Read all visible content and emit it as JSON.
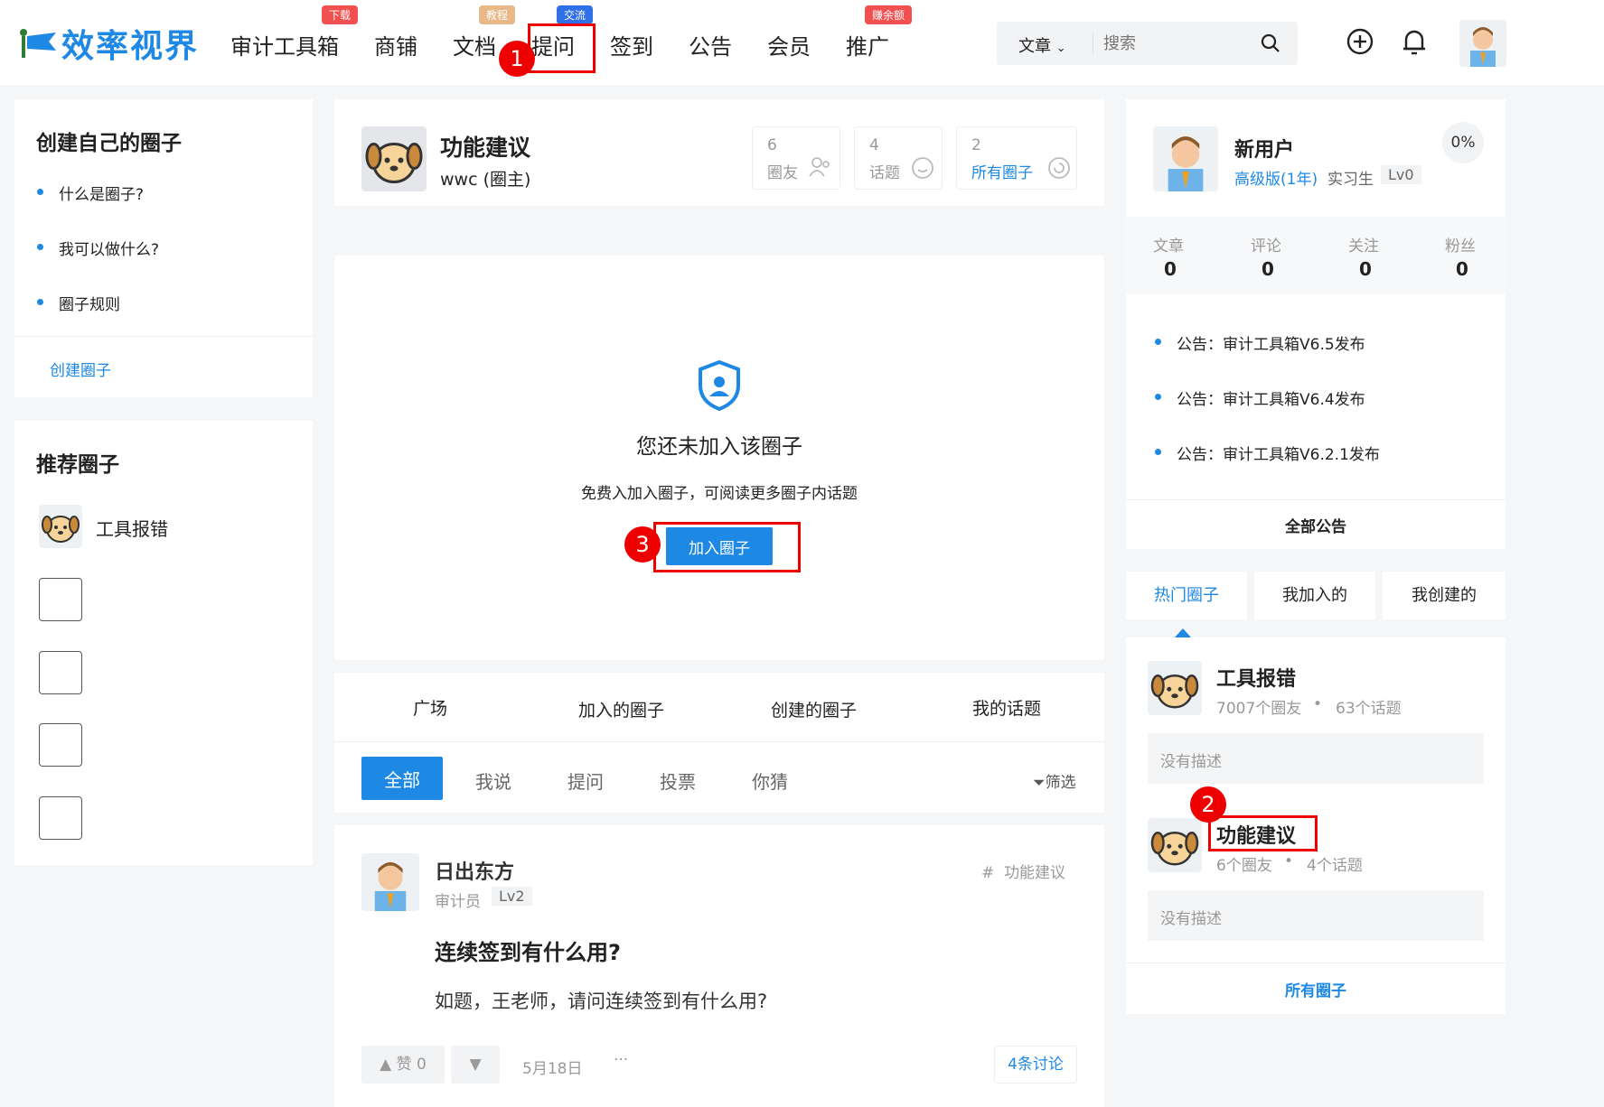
{
  "header": {
    "logo_text": "效率视界",
    "nav": [
      {
        "label": "审计工具箱",
        "badge": "下载",
        "badge_color": "#f05050"
      },
      {
        "label": "商铺"
      },
      {
        "label": "文档",
        "badge": "教程",
        "badge_color": "#e8b887"
      },
      {
        "label": "提问",
        "badge": "交流",
        "badge_color": "#2f6fe8"
      },
      {
        "label": "签到"
      },
      {
        "label": "公告"
      },
      {
        "label": "会员"
      },
      {
        "label": "推广",
        "badge": "赚余额",
        "badge_color": "#f05050"
      }
    ],
    "search": {
      "category": "文章",
      "placeholder": "搜索"
    },
    "icons": [
      "add-circle-icon",
      "bell-icon",
      "avatar"
    ]
  },
  "markers": [
    "1",
    "2",
    "3"
  ],
  "left": {
    "create_card": {
      "title": "创建自己的圈子",
      "items": [
        "什么是圈子?",
        "我可以做什么?",
        "圈子规则"
      ],
      "link": "创建圈子"
    },
    "recommend_card": {
      "title": "推荐圈子",
      "first_item": "工具报错"
    }
  },
  "center": {
    "circle": {
      "name": "功能建议",
      "owner": "wwc (圈主)",
      "stats": [
        {
          "num": "6",
          "label": "圈友"
        },
        {
          "num": "4",
          "label": "话题"
        },
        {
          "num": "2",
          "label": "所有圈子"
        }
      ]
    },
    "join": {
      "title": "您还未加入该圈子",
      "desc": "免费入加入圈子，可阅读更多圈子内话题",
      "button": "加入圈子"
    },
    "tabs": [
      "广场",
      "加入的圈子",
      "创建的圈子",
      "我的话题"
    ],
    "filters": [
      "全部",
      "我说",
      "提问",
      "投票",
      "你猜"
    ],
    "filter_button": "筛选",
    "post": {
      "author": "日出东方",
      "role": "审计员",
      "level": "Lv2",
      "tag": "功能建议",
      "title": "连续签到有什么用?",
      "body": "如题，王老师，请问连续签到有什么用?",
      "like": "赞 0",
      "date": "5月18日",
      "more": "···",
      "discuss": "4条讨论"
    }
  },
  "right": {
    "user": {
      "name": "新用户",
      "vip": "高级版(1年)",
      "title": "实习生",
      "level": "Lv0",
      "progress": "0%",
      "stats": [
        {
          "label": "文章",
          "value": "0"
        },
        {
          "label": "评论",
          "value": "0"
        },
        {
          "label": "关注",
          "value": "0"
        },
        {
          "label": "粉丝",
          "value": "0"
        }
      ]
    },
    "notices": [
      "公告：审计工具箱V6.5发布",
      "公告：审计工具箱V6.4发布",
      "公告：审计工具箱V6.2.1发布"
    ],
    "notices_all": "全部公告",
    "circle_tabs": [
      "热门圈子",
      "我加入的",
      "我创建的"
    ],
    "hot_circles": [
      {
        "name": "工具报错",
        "meta1": "7007个圈友",
        "meta2": "63个话题",
        "desc": "没有描述"
      },
      {
        "name": "功能建议",
        "meta1": "6个圈友",
        "meta2": "4个话题",
        "desc": "没有描述"
      }
    ],
    "all_circles": "所有圈子"
  }
}
